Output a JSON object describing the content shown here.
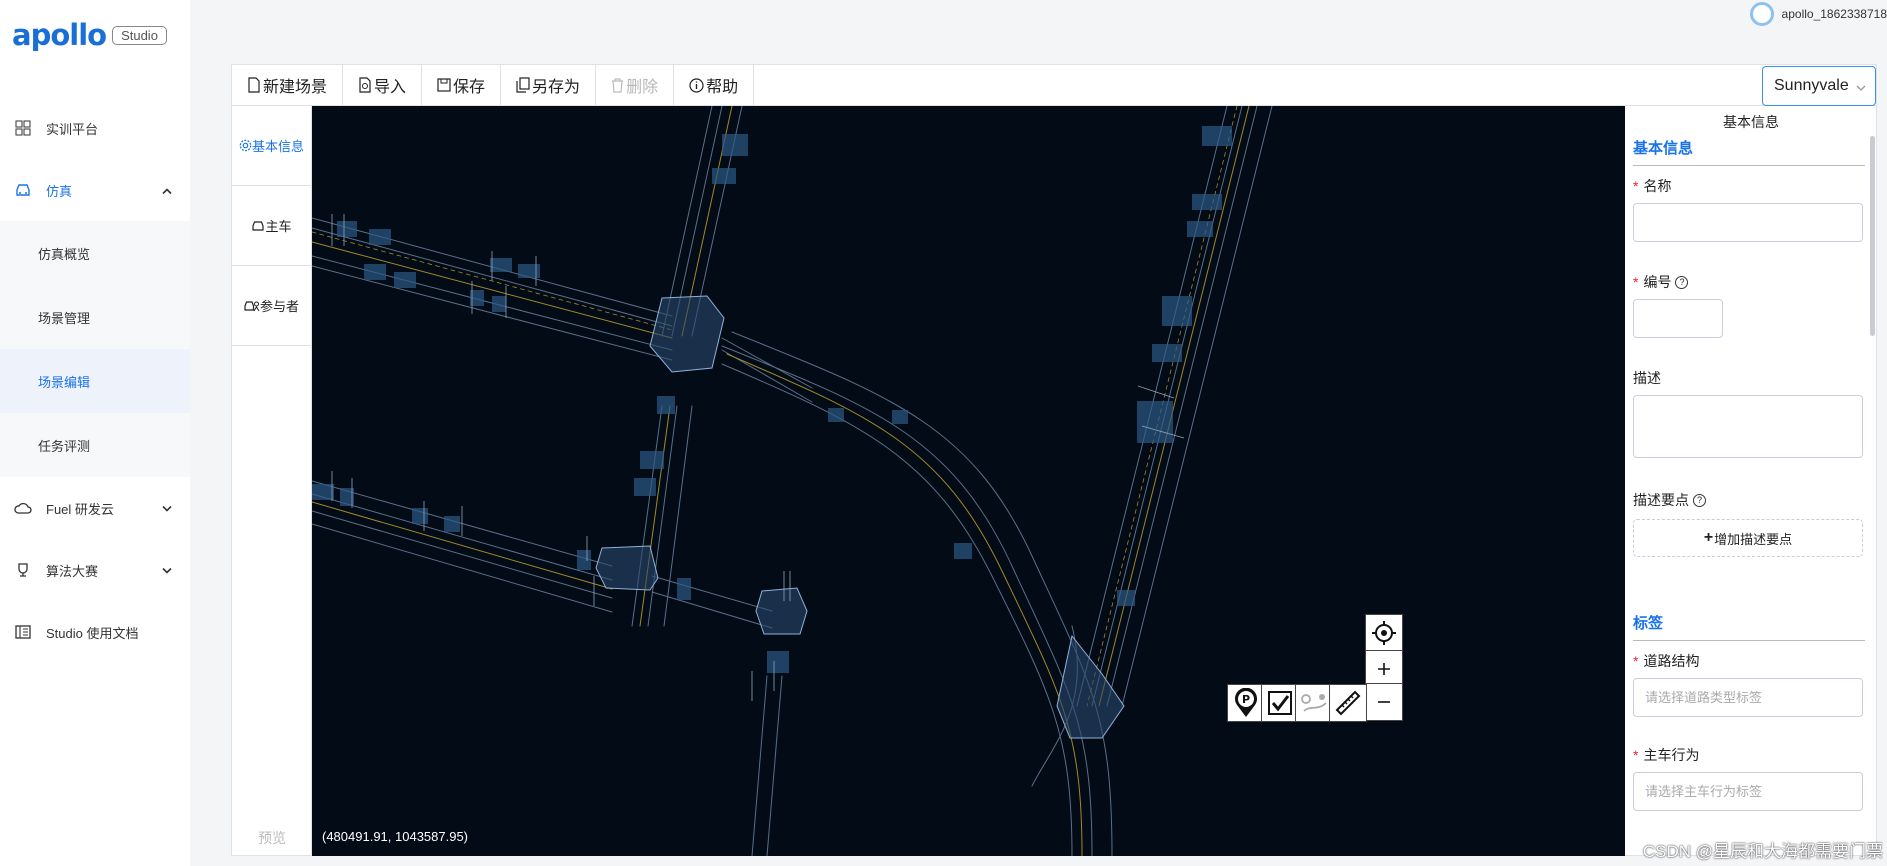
{
  "brand": {
    "logo_text": "apollo",
    "badge": "Studio"
  },
  "user": {
    "name": "apollo_1862338718"
  },
  "sidebar": {
    "items": [
      {
        "label": "实训平台",
        "icon": "grid-icon"
      },
      {
        "label": "仿真",
        "icon": "car-icon",
        "expanded": true
      },
      {
        "label": "Fuel 研发云",
        "icon": "cloud-icon"
      },
      {
        "label": "算法大赛",
        "icon": "trophy-icon"
      },
      {
        "label": "Studio 使用文档",
        "icon": "doc-icon"
      }
    ],
    "sub_items": [
      {
        "label": "仿真概览"
      },
      {
        "label": "场景管理"
      },
      {
        "label": "场景编辑",
        "active": true
      },
      {
        "label": "任务评测"
      }
    ]
  },
  "toolbar": {
    "new_scene": "新建场景",
    "import": "导入",
    "save": "保存",
    "save_as": "另存为",
    "delete": "删除",
    "help": "帮助",
    "city": "Sunnyvale"
  },
  "tabs": [
    {
      "label": "基本信息",
      "active": true
    },
    {
      "label": "主车"
    },
    {
      "label": "参与者"
    }
  ],
  "preview_label": "预览",
  "map": {
    "coordinates": "(480491.91, 1043587.95)"
  },
  "form": {
    "title": "基本信息",
    "section_basic": "基本信息",
    "name_label": "名称",
    "id_label": "编号",
    "desc_label": "描述",
    "points_label": "描述要点",
    "add_points": "增加描述要点",
    "section_tags": "标签",
    "road_label": "道路结构",
    "road_placeholder": "请选择道路类型标签",
    "ego_label": "主车行为",
    "ego_placeholder": "请选择主车行为标签"
  },
  "watermark": "CSDN @星辰和大海都需要门票",
  "colors": {
    "accent": "#1a73e8",
    "map_bg": "#030b16"
  }
}
